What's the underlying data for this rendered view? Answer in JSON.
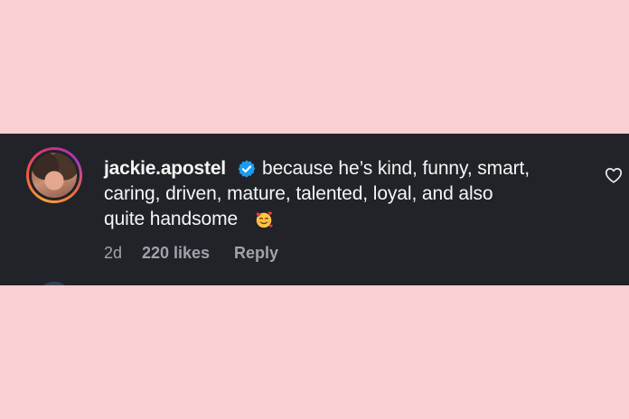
{
  "comment": {
    "username": "jackie.apostel",
    "verified": true,
    "text_lines": [
      "because he’s kind, funny, smart,",
      "caring, driven, mature, talented, loyal, and also",
      "quite handsome"
    ],
    "emoji": "smiling-face-with-hearts-icon",
    "age": "2d",
    "likes": "220 likes",
    "reply_label": "Reply"
  },
  "colors": {
    "page_background": "#f9cfd1",
    "card_background": "#212328",
    "primary_text": "#f5f5f5",
    "secondary_text": "#9ea3ab",
    "verified_badge": "#1d9bf0"
  }
}
